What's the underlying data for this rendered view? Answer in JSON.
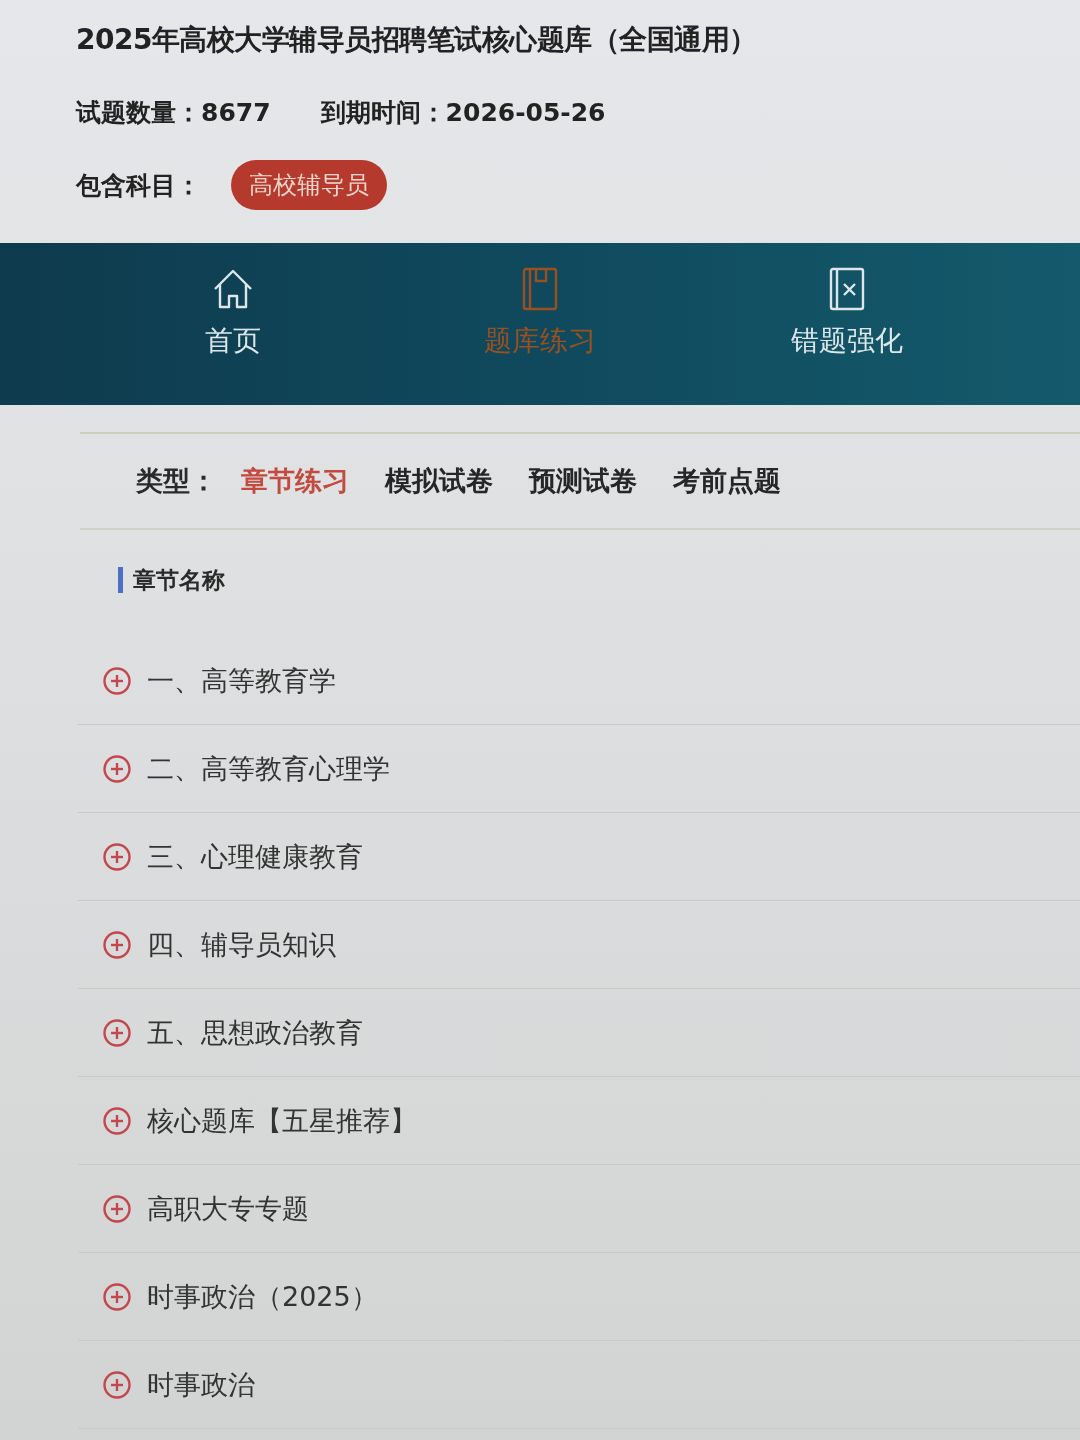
{
  "header": {
    "title": "2025年高校大学辅导员招聘笔试核心题库（全国通用）",
    "question_count": {
      "label": "试题数量：",
      "value": "8677"
    },
    "expiry": {
      "label": "到期时间：",
      "value": "2026-05-26"
    },
    "subjects": {
      "label": "包含科目：",
      "tags": [
        "高校辅导员"
      ]
    }
  },
  "nav": [
    {
      "kind": "home",
      "label": "首页",
      "selected": false
    },
    {
      "kind": "notebook",
      "label": "题库练习",
      "selected": true
    },
    {
      "kind": "wrong",
      "label": "错题强化",
      "selected": false
    }
  ],
  "filter": {
    "label": "类型：",
    "options": [
      {
        "label": "章节练习",
        "selected": true
      },
      {
        "label": "模拟试卷",
        "selected": false
      },
      {
        "label": "预测试卷",
        "selected": false
      },
      {
        "label": "考前点题",
        "selected": false
      }
    ]
  },
  "section": {
    "heading": "章节名称"
  },
  "chapters": [
    {
      "title": "一、高等教育学",
      "expanded": false
    },
    {
      "title": "二、高等教育心理学",
      "expanded": false
    },
    {
      "title": "三、心理健康教育",
      "expanded": false
    },
    {
      "title": "四、辅导员知识",
      "expanded": false
    },
    {
      "title": "五、思想政治教育",
      "expanded": false
    },
    {
      "title": "核心题库【五星推荐】",
      "expanded": false
    },
    {
      "title": "高职大专专题",
      "expanded": false
    },
    {
      "title": "时事政治（2025）",
      "expanded": false
    },
    {
      "title": "时事政治",
      "expanded": false
    }
  ]
}
